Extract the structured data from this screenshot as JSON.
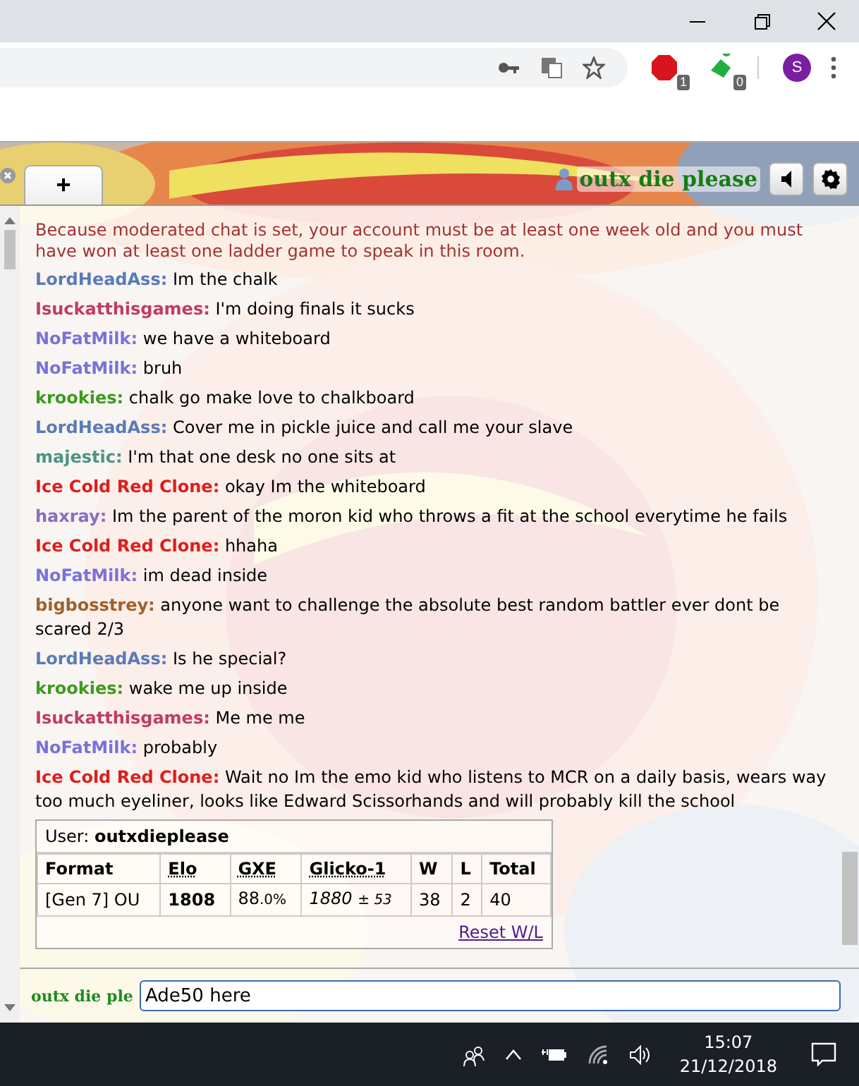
{
  "browser": {
    "extensions": [
      {
        "kind": "abp",
        "badge": "1"
      },
      {
        "kind": "green",
        "badge": "0"
      }
    ],
    "profile_initial": "S"
  },
  "room": {
    "new_tab": "+",
    "username": "outx die please",
    "messages": [
      {
        "kind": "system",
        "text": "Because moderated chat is set, your account must be at least one week old and you must have won at least one ladder game to speak in this room."
      },
      {
        "kind": "chat",
        "user": "LordHeadAss:",
        "color": "#5a7ab8",
        "text": "Im the chalk"
      },
      {
        "kind": "chat",
        "user": "Isuckatthisgames:",
        "color": "#c03c64",
        "text": "I'm doing finals it sucks"
      },
      {
        "kind": "chat",
        "user": "NoFatMilk:",
        "color": "#7a72d8",
        "text": "we have a whiteboard"
      },
      {
        "kind": "chat",
        "user": "NoFatMilk:",
        "color": "#7a72d8",
        "text": "bruh"
      },
      {
        "kind": "chat",
        "user": "krookies:",
        "color": "#3c9a1e",
        "text": "chalk go make love to chalkboard"
      },
      {
        "kind": "chat",
        "user": "LordHeadAss:",
        "color": "#5a7ab8",
        "text": "Cover me in pickle juice and call me your slave"
      },
      {
        "kind": "chat",
        "user": "majestic:",
        "color": "#4a9486",
        "text": "I'm that one desk no one sits at"
      },
      {
        "kind": "chat",
        "user": "Ice Cold Red Clone:",
        "color": "#e01c1c",
        "text": "okay Im the whiteboard"
      },
      {
        "kind": "chat",
        "user": "haxray:",
        "color": "#8a6cc4",
        "text": "Im the parent of the moron kid who throws a fit at the school everytime he fails"
      },
      {
        "kind": "chat",
        "user": "Ice Cold Red Clone:",
        "color": "#e01c1c",
        "text": "hhaha"
      },
      {
        "kind": "chat",
        "user": "NoFatMilk:",
        "color": "#7a72d8",
        "text": "im dead inside"
      },
      {
        "kind": "chat",
        "user": "bigbosstrey:",
        "color": "#a0602c",
        "text": "anyone want to challenge the absolute best random battler ever dont be scared 2/3"
      },
      {
        "kind": "chat",
        "user": "LordHeadAss:",
        "color": "#5a7ab8",
        "text": "Is he special?"
      },
      {
        "kind": "chat",
        "user": "krookies:",
        "color": "#3c9a1e",
        "text": "wake me up inside"
      },
      {
        "kind": "chat",
        "user": "Isuckatthisgames:",
        "color": "#c03c64",
        "text": "Me me me"
      },
      {
        "kind": "chat",
        "user": "NoFatMilk:",
        "color": "#7a72d8",
        "text": "probably"
      },
      {
        "kind": "chat",
        "user": "Ice Cold Red Clone:",
        "color": "#e01c1c",
        "text": "Wait no Im the emo kid who listens to MCR on a daily basis, wears way too much eyeliner, looks like Edward Scissorhands and will probably kill the school"
      }
    ],
    "ladder": {
      "user_line": "User: **outxdieplease**",
      "columns": [
        "Format",
        "Elo",
        "GXE",
        "Glicko-1",
        "W",
        "L",
        "Total"
      ],
      "row": {
        "format": "[Gen 7] OU",
        "elo": "1808",
        "gxe": "88",
        "gxe_small": ".0%",
        "glicko": "1880",
        "glicko_small": "± 53",
        "w": "38",
        "l": "2",
        "total": "40"
      },
      "reset_link": "Reset W/L"
    },
    "input": {
      "label": "outx die ple",
      "value": "Ade50 here"
    }
  },
  "taskbar": {
    "time": "15:07",
    "date": "21/12/2018"
  }
}
